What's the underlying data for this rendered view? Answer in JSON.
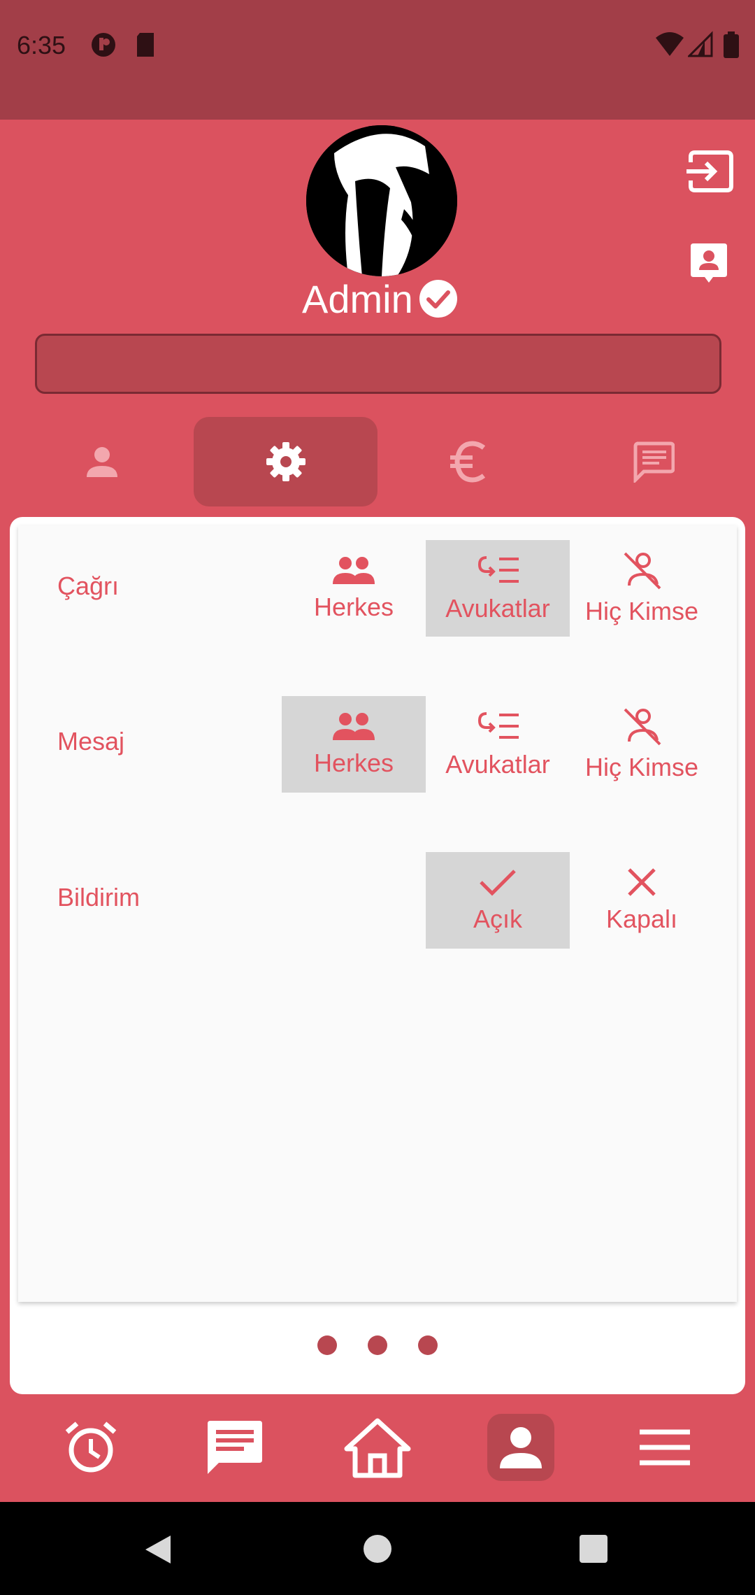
{
  "status_bar": {
    "time": "6:35"
  },
  "profile": {
    "name": "Admin"
  },
  "search": {
    "value": "",
    "placeholder": ""
  },
  "settings": {
    "rows": [
      {
        "label": "Çağrı",
        "options": [
          "Herkes",
          "Avukatlar",
          "Hiç Kimse"
        ],
        "selected": "Avukatlar"
      },
      {
        "label": "Mesaj",
        "options": [
          "Herkes",
          "Avukatlar",
          "Hiç Kimse"
        ],
        "selected": "Herkes"
      },
      {
        "label": "Bildirim",
        "options": [
          "Açık",
          "Kapalı"
        ],
        "selected": "Açık"
      }
    ]
  },
  "tabs": {
    "items": [
      "person-icon",
      "gear-icon",
      "euro-icon",
      "chat-icon"
    ],
    "active": "gear-icon"
  },
  "bottom_nav": {
    "items": [
      "alarm-icon",
      "message-icon",
      "home-icon",
      "account-icon",
      "menu-icon"
    ],
    "active": "account-icon"
  },
  "pager": {
    "pages": 3
  },
  "colors": {
    "primary": "#db525f",
    "dark": "#b84750",
    "status_bar": "#a23e48",
    "accent_text": "#e2535f",
    "selected_bg": "#d6d6d6"
  }
}
